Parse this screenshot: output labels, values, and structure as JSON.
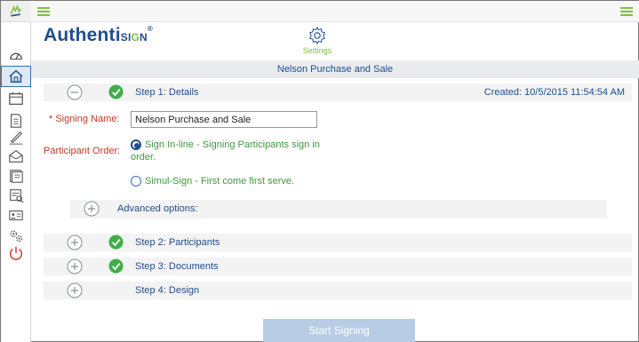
{
  "brand": {
    "name": "Authenti",
    "sign_prefix": "SI",
    "sign_accent": "G",
    "sign_suffix": "N",
    "tm": "®"
  },
  "settings": {
    "label": "Settings"
  },
  "title": "Nelson Purchase and Sale",
  "steps": [
    {
      "label": "Step 1: Details",
      "completed": true,
      "expanded": true,
      "created": "Created: 10/5/2015 11:54:54 AM"
    },
    {
      "label": "Step 2: Participants",
      "completed": true,
      "expanded": false
    },
    {
      "label": "Step 3: Documents",
      "completed": true,
      "expanded": false
    },
    {
      "label": "Step 4: Design",
      "completed": false,
      "expanded": false
    }
  ],
  "form": {
    "signing_name_label": "* Signing Name:",
    "signing_name_value": "Nelson Purchase and Sale",
    "participant_order_label": "Participant Order:",
    "options": [
      {
        "label_line1": "Sign In-line - Signing Participants sign in",
        "label_line2": "order.",
        "selected": true
      },
      {
        "label_line1": "Simul-Sign - First come first serve.",
        "selected": false
      }
    ],
    "advanced_label": "Advanced options:"
  },
  "start_button": {
    "label": "Start Signing",
    "enabled": false
  },
  "colors": {
    "brand_blue": "#1f4e8c",
    "accent_green": "#7cc142",
    "required_red": "#c0392b",
    "option_green": "#3d9b3d"
  },
  "rail_icons": [
    "logo-icon",
    "dashboard-icon",
    "home-icon",
    "calendar-icon",
    "document-icon",
    "pen-icon",
    "envelope-icon",
    "templates-icon",
    "review-icon",
    "contact-card-icon",
    "admin-gears-icon",
    "power-icon"
  ]
}
